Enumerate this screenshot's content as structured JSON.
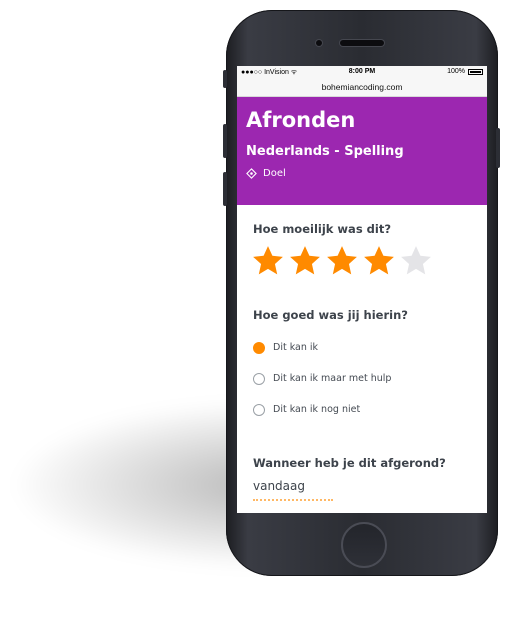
{
  "status_bar": {
    "carrier": "●●●○○ InVision ᯤ",
    "time": "8:00 PM",
    "battery": "100%"
  },
  "browser": {
    "url": "bohemiancoding.com"
  },
  "header": {
    "title": "Afronden",
    "subtitle": "Nederlands - Spelling",
    "goal_label": "Doel",
    "goal_icon": "target-icon",
    "color": "#9c27b0"
  },
  "rating": {
    "question": "Hoe moeilijk was dit?",
    "value": 4,
    "max": 5,
    "filled_color": "#ff8a00",
    "empty_color": "#e4e4e7"
  },
  "skill": {
    "question": "Hoe goed was jij hierin?",
    "options": [
      {
        "label": "Dit kan ik",
        "selected": true
      },
      {
        "label": "Dit kan ik maar met hulp",
        "selected": false
      },
      {
        "label": "Dit kan ik nog niet",
        "selected": false
      }
    ],
    "accent": "#ff8a00"
  },
  "completion": {
    "question": "Wanneer heb je dit afgerond?",
    "value": "vandaag"
  }
}
